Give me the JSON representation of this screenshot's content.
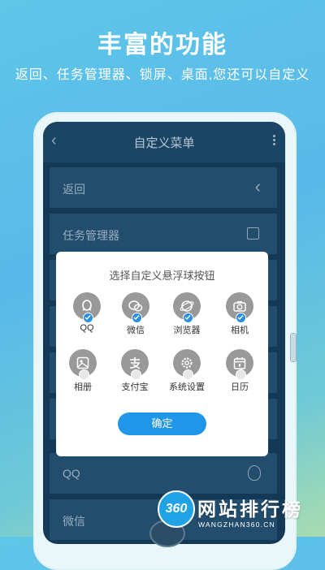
{
  "promo": {
    "headline": "丰富的功能",
    "subline": "返回、任务管理器、锁屏、桌面,您还可以自定义"
  },
  "appbar": {
    "title": "自定义菜单",
    "back_icon": "chevron-left-icon",
    "more_icon": "more-vert-icon"
  },
  "menu_rows": [
    {
      "label": "返回",
      "trailing": "chevron-left-icon"
    },
    {
      "label": "任务管理器",
      "trailing": "checkbox-icon"
    },
    {
      "label": "QQ",
      "trailing": "qq-icon"
    },
    {
      "label": "微信",
      "trailing": "wechat-icon"
    }
  ],
  "dialog": {
    "title": "选择自定义悬浮球按钮",
    "items": [
      {
        "label": "QQ",
        "icon": "qq-icon",
        "checked": true
      },
      {
        "label": "微信",
        "icon": "wechat-icon",
        "checked": true
      },
      {
        "label": "浏览器",
        "icon": "browser-icon",
        "checked": true
      },
      {
        "label": "相机",
        "icon": "camera-icon",
        "checked": true
      },
      {
        "label": "相册",
        "icon": "gallery-icon",
        "checked": false
      },
      {
        "label": "支付宝",
        "icon": "alipay-icon",
        "checked": false
      },
      {
        "label": "系统设置",
        "icon": "settings-icon",
        "checked": false
      },
      {
        "label": "日历",
        "icon": "calendar-icon",
        "checked": false
      }
    ],
    "confirm_label": "确定"
  },
  "watermark": {
    "logo_text": "360",
    "name": "网站排行榜",
    "url": "WANGZHAN360.CN"
  },
  "colors": {
    "checked_badge": "#2a8fe0",
    "confirm_button": "#2196e8",
    "icon_circle": "#999999"
  }
}
